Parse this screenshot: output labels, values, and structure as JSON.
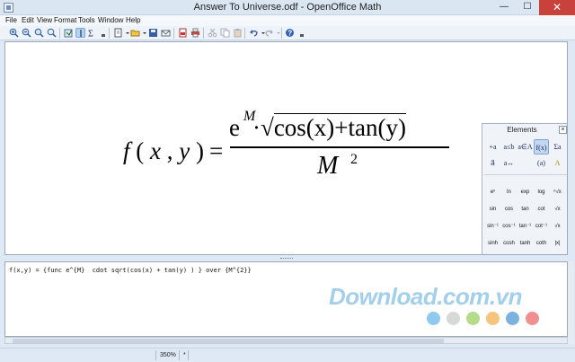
{
  "window": {
    "title": "Answer To Universe.odf - OpenOffice Math",
    "minimize": "—",
    "maximize": "☐",
    "close": "✕"
  },
  "menu": [
    "File",
    "Edit",
    "View",
    "Format",
    "Tools",
    "Window",
    "Help"
  ],
  "formula": {
    "lhs_f": "f",
    "lhs_open": "(",
    "lhs_x": "x",
    "lhs_comma": ",",
    "lhs_y": "y",
    "lhs_close": ")",
    "equals": "=",
    "num_e": "e",
    "num_sup": "M",
    "num_dot": "·",
    "num_sqrt": "√",
    "num_body": "cos(x)+tan(y)",
    "den_base": "M",
    "den_sup": "2"
  },
  "elements_panel": {
    "title": "Elements",
    "close": "×",
    "categories": [
      "+a",
      "a≤b",
      "a∈A",
      "f(x)",
      "Σa",
      "a⃗",
      "a↔",
      "(a)",
      "A"
    ],
    "functions": [
      "eˣ",
      "ln",
      "exp",
      "log",
      "ⁿ√x",
      "sin",
      "cos",
      "tan",
      "cot",
      "√x",
      "sin⁻¹",
      "cos⁻¹",
      "tan⁻¹",
      "cot⁻¹",
      "√x",
      "sinh",
      "cosh",
      "tanh",
      "coth",
      "|x|"
    ]
  },
  "editor": {
    "text": "f(x,y) = {func e^{M}  cdot sqrt(cos(x) + tan(y) ) } over {M^{2}}"
  },
  "watermark": {
    "text": "Download.com.vn"
  },
  "dots_colors": [
    "#8ec9ee",
    "#d8d8d8",
    "#b5dc8c",
    "#f6c47c",
    "#7ab3e0",
    "#f08f8f"
  ],
  "status": {
    "zoom": "350%",
    "modified": "*"
  }
}
